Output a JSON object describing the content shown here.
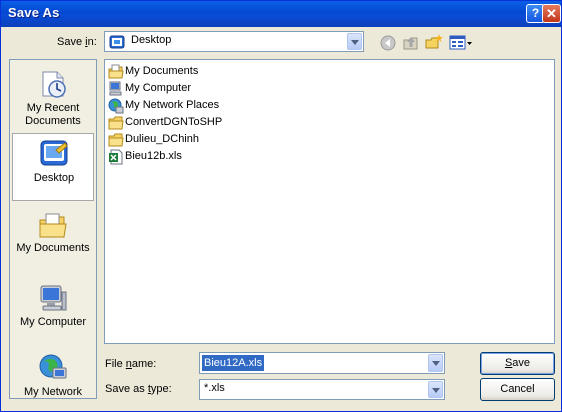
{
  "window": {
    "title": "Save As"
  },
  "title_buttons": {
    "help": "?",
    "close": "✕"
  },
  "save_in": {
    "label_pre": "Save ",
    "label_key": "i",
    "label_post": "n:",
    "value": "Desktop"
  },
  "toolbar": {
    "icons": [
      "back-icon",
      "up-folder-icon",
      "new-folder-icon",
      "views-menu-icon"
    ]
  },
  "places": [
    {
      "line1": "My Recent",
      "line2": "Documents",
      "icon": "recent-documents-icon",
      "selected": false
    },
    {
      "line1": "Desktop",
      "line2": "",
      "icon": "desktop-icon",
      "selected": true
    },
    {
      "line1": "My Documents",
      "line2": "",
      "icon": "my-documents-icon",
      "selected": false
    },
    {
      "line1": "My Computer",
      "line2": "",
      "icon": "my-computer-icon",
      "selected": false
    },
    {
      "line1": "My Network",
      "line2": "",
      "icon": "my-network-icon",
      "selected": false
    }
  ],
  "files": [
    {
      "name": "My Documents",
      "icon": "my-documents-icon"
    },
    {
      "name": "My Computer",
      "icon": "my-computer-icon"
    },
    {
      "name": "My Network Places",
      "icon": "network-places-icon"
    },
    {
      "name": "ConvertDGNToSHP",
      "icon": "folder-icon"
    },
    {
      "name": "Dulieu_DChinh",
      "icon": "folder-icon"
    },
    {
      "name": "Bieu12b.xls",
      "icon": "excel-file-icon"
    }
  ],
  "file_name": {
    "label_pre": "File ",
    "label_key": "n",
    "label_post": "ame:",
    "value": "Bieu12A.xls"
  },
  "save_as_type": {
    "label_pre": "Save as ",
    "label_key": "t",
    "label_post": "ype:",
    "value": "*.xls"
  },
  "buttons": {
    "save_key": "S",
    "save_rest": "ave",
    "cancel": "Cancel"
  },
  "colors": {
    "title_bar": "#0548d0",
    "dialog_bg": "#ece9d8",
    "selection": "#316ac5",
    "border": "#7f9db9"
  }
}
